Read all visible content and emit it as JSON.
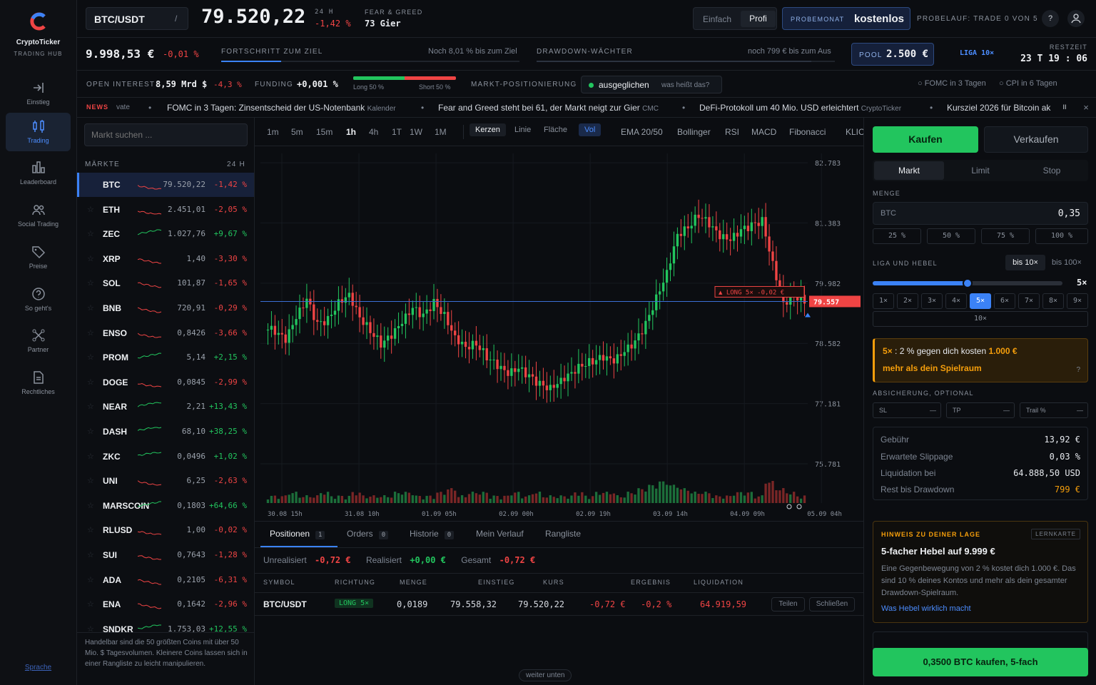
{
  "brand": {
    "name": "CryptoTicker",
    "sub": "TRADING HUB"
  },
  "nav": [
    {
      "label": "Einstieg",
      "icon": "enter-icon"
    },
    {
      "label": "Trading",
      "icon": "candles-icon"
    },
    {
      "label": "Leaderboard",
      "icon": "bars-icon"
    },
    {
      "label": "Social Trading",
      "icon": "people-icon"
    },
    {
      "label": "Preise",
      "icon": "tag-icon"
    },
    {
      "label": "So geht's",
      "icon": "question-icon"
    },
    {
      "label": "Partner",
      "icon": "partner-icon"
    },
    {
      "label": "Rechtliches",
      "icon": "document-icon"
    }
  ],
  "nav_footer": "Sprache",
  "header": {
    "pair": "BTC/USDT",
    "pair_sep": "/",
    "price": "79.520,22",
    "change_label": "24 H",
    "change": "-1,42 %",
    "fg_label": "FEAR & GREED",
    "fg_value": "73 Gier",
    "mode_simple": "Einfach",
    "mode_pro": "Profi",
    "promo_small": "PROBEMONAT",
    "promo_big": "kostenlos",
    "trial": "PROBELAUF: TRADE 0 VON 5",
    "help": "?"
  },
  "row2": {
    "balance": "9.998,53 €",
    "balance_change": "-0,01 %",
    "progress_label": "FORTSCHRITT ZUM ZIEL",
    "progress_note": "Noch 8,01 % bis zum Ziel",
    "progress_value": 0.2,
    "drawdown_label": "DRAWDOWN-WÄCHTER",
    "drawdown_note": "noch 799 € bis zum Aus",
    "drawdown_value": 0.92,
    "pool_label": "POOL",
    "pool_value": "2.500 €",
    "league": "LIGA 10×",
    "time_label": "RESTZEIT",
    "time_value": "23 T 19 : 06"
  },
  "row3": {
    "oi_label": "OPEN INTEREST",
    "oi_value": "8,59 Mrd $",
    "oi_change": "-4,3 %",
    "funding_label": "FUNDING",
    "funding_value": "+0,001 %",
    "long_label": "Long 50 %",
    "short_label": "Short 50 %",
    "long_ratio": 0.5,
    "pos_label": "MARKT-POSITIONIERUNG",
    "pos_value": "ausgeglichen",
    "pos_hint": "was heißt das?",
    "event1": "FOMC in 3 Tagen",
    "event2": "CPI in 6 Tagen"
  },
  "news": {
    "tag": "NEWS",
    "items": [
      {
        "text": "vate",
        "src": ""
      },
      {
        "text": "FOMC in 3 Tagen: Zinsentscheid der US-Notenbank",
        "src": "Kalender"
      },
      {
        "text": "Fear and Greed steht bei 61, der Markt neigt zur Gier",
        "src": "CMC"
      },
      {
        "text": "DeFi-Protokoll um 40 Mio. USD erleichtert",
        "src": "CryptoTicker"
      },
      {
        "text": "Kursziel 2026 für Bitcoin ak",
        "src": ""
      }
    ],
    "pause": "II",
    "close": "×"
  },
  "markets": {
    "search_placeholder": "Markt suchen ...",
    "header": "MÄRKTE",
    "col": "24 H",
    "note": "Handelbar sind die 50 größten Coins mit über 50 Mio. $ Tagesvolumen. Kleinere Coins lassen sich in einer Rangliste zu leicht manipulieren.",
    "rows": [
      {
        "sym": "BTC",
        "price": "79.520,22",
        "chg": "-1,42 %",
        "dir": "dn"
      },
      {
        "sym": "ETH",
        "price": "2.451,01",
        "chg": "-2,05 %",
        "dir": "dn"
      },
      {
        "sym": "ZEC",
        "price": "1.027,76",
        "chg": "+9,67 %",
        "dir": "up"
      },
      {
        "sym": "XRP",
        "price": "1,40",
        "chg": "-3,30 %",
        "dir": "dn"
      },
      {
        "sym": "SOL",
        "price": "101,87",
        "chg": "-1,65 %",
        "dir": "dn"
      },
      {
        "sym": "BNB",
        "price": "720,91",
        "chg": "-0,29 %",
        "dir": "dn"
      },
      {
        "sym": "ENSO",
        "price": "0,8426",
        "chg": "-3,66 %",
        "dir": "dn"
      },
      {
        "sym": "PROM",
        "price": "5,14",
        "chg": "+2,15 %",
        "dir": "up"
      },
      {
        "sym": "DOGE",
        "price": "0,0845",
        "chg": "-2,99 %",
        "dir": "dn"
      },
      {
        "sym": "NEAR",
        "price": "2,21",
        "chg": "+13,43 %",
        "dir": "up"
      },
      {
        "sym": "DASH",
        "price": "68,10",
        "chg": "+38,25 %",
        "dir": "up"
      },
      {
        "sym": "ZKC",
        "price": "0,0496",
        "chg": "+1,02 %",
        "dir": "up"
      },
      {
        "sym": "UNI",
        "price": "6,25",
        "chg": "-2,63 %",
        "dir": "dn"
      },
      {
        "sym": "MARSCOIN",
        "price": "0,1803",
        "chg": "+64,66 %",
        "dir": "up"
      },
      {
        "sym": "RLUSD",
        "price": "1,00",
        "chg": "-0,02 %",
        "dir": "dn"
      },
      {
        "sym": "SUI",
        "price": "0,7643",
        "chg": "-1,28 %",
        "dir": "dn"
      },
      {
        "sym": "ADA",
        "price": "0,2105",
        "chg": "-6,31 %",
        "dir": "dn"
      },
      {
        "sym": "ENA",
        "price": "0,1642",
        "chg": "-2,96 %",
        "dir": "dn"
      },
      {
        "sym": "SNDKR",
        "price": "1.753,03",
        "chg": "+12,55 %",
        "dir": "up"
      }
    ]
  },
  "toolbar": {
    "timeframes": [
      "1m",
      "5m",
      "15m",
      "1h",
      "4h",
      "1T",
      "1W",
      "1M"
    ],
    "active_tf": "1h",
    "types": [
      "Kerzen",
      "Linie",
      "Fläche",
      "Vol"
    ],
    "indicators": [
      "EMA 20/50",
      "Bollinger",
      "RSI",
      "MACD",
      "Fibonacci",
      "KLIC"
    ]
  },
  "chart_data": {
    "type": "candlestick",
    "yticks": [
      "82.783",
      "81.383",
      "79.982",
      "78.582",
      "77.181",
      "75.781"
    ],
    "xticks": [
      "30.08 15h",
      "31.08 10h",
      "01.09 05h",
      "02.09 00h",
      "02.09 19h",
      "03.09 14h",
      "04.09 09h",
      "05.09 04h"
    ],
    "last_price": "79.557",
    "position_tag": "▲ LONG 5× -0,02 €",
    "close_series": [
      78.9,
      78.7,
      79.2,
      79.6,
      79.0,
      79.1,
      79.5,
      79.7,
      79.2,
      78.9,
      78.6,
      78.8,
      79.1,
      79.4,
      79.2,
      79.5,
      79.2,
      78.7,
      78.5,
      78.6,
      78.3,
      78.1,
      77.9,
      78.0,
      77.8,
      77.6,
      77.5,
      77.7,
      77.9,
      78.1,
      78.2,
      78.3,
      78.2,
      78.4,
      78.6,
      79.0,
      79.6,
      80.2,
      81.1,
      81.3,
      81.6,
      81.4,
      81.1,
      81.0,
      81.2,
      81.3,
      81.4,
      80.4,
      79.5,
      79.7,
      79.6
    ],
    "vol": [
      1,
      1,
      2,
      1,
      1,
      2,
      1,
      1,
      2,
      1,
      1,
      1,
      2,
      2,
      1,
      1,
      2,
      3,
      1,
      2,
      2,
      1,
      1,
      2,
      1,
      2,
      1,
      1,
      1,
      2,
      1,
      2,
      2,
      1,
      2,
      3,
      4,
      5,
      4,
      3,
      2,
      2,
      1,
      1,
      2,
      2,
      1,
      5,
      3,
      2,
      1
    ]
  },
  "bottom": {
    "tabs": [
      {
        "label": "Positionen",
        "count": "1"
      },
      {
        "label": "Orders",
        "count": "0"
      },
      {
        "label": "Historie",
        "count": "0"
      },
      {
        "label": "Mein Verlauf",
        "count": ""
      },
      {
        "label": "Rangliste",
        "count": ""
      }
    ],
    "unreal_label": "Unrealisiert",
    "unreal": "-0,72 €",
    "real_label": "Realisiert",
    "real": "+0,00 €",
    "total_label": "Gesamt",
    "total": "-0,72 €",
    "cols": [
      "SYMBOL",
      "RICHTUNG",
      "MENGE",
      "EINSTIEG",
      "KURS",
      "ERGEBNIS",
      "LIQUIDATION"
    ],
    "row": {
      "sym": "BTC/USDT",
      "dir": "LONG 5×",
      "qty": "0,0189",
      "entry": "79.558,32",
      "price": "79.520,22",
      "pnl": "-0,72 €",
      "pnl_pct": "-0,2 %",
      "liq": "64.919,59"
    },
    "share": "Teilen",
    "close": "Schließen",
    "scroll": "weiter unten"
  },
  "order": {
    "buy": "Kaufen",
    "sell": "Verkaufen",
    "types": [
      "Markt",
      "Limit",
      "Stop"
    ],
    "qty_label": "MENGE",
    "qty_asset": "BTC",
    "qty_value": "0,35",
    "pcts": [
      "25 %",
      "50 %",
      "75 %",
      "100 %"
    ],
    "lev_label": "LIGA UND HEBEL",
    "lev_opt1": "bis 10×",
    "lev_opt2": "bis 100×",
    "lev_value": "5×",
    "lev_fraction": 0.5,
    "lev_steps": [
      "1×",
      "2×",
      "3×",
      "4×",
      "5×",
      "6×",
      "7×",
      "8×",
      "9×",
      "10×"
    ],
    "active_step": "5×",
    "warn_line1a": "5×",
    "warn_line1b": ": 2 % gegen dich kosten",
    "warn_line1c": "1.000 €",
    "warn_line2": "mehr als dein Spielraum",
    "warn_help": "?",
    "protect_label": "ABSICHERUNG, OPTIONAL",
    "sl": "SL",
    "tp": "TP",
    "trail": "Trail %",
    "dash": "—",
    "fee_label": "Gebühr",
    "fee": "13,92 €",
    "slip_label": "Erwartete Slippage",
    "slip": "0,03 %",
    "liq_label": "Liquidation bei",
    "liq": "64.888,50 USD",
    "rest_label": "Rest bis Drawdown",
    "rest": "799 €",
    "hint_title": "HINWEIS ZU DEINER LAGE",
    "hint_tag": "LERNKARTE",
    "hint_head": "5-facher Hebel auf 9.999 €",
    "hint_body": "Eine Gegenbewegung von 2 % kostet dich 1.000 €. Das sind 10 % deines Kontos und mehr als dein gesamter Drawdown-Spielraum.",
    "hint_link": "Was Hebel wirklich macht",
    "cta": "0,3500 BTC kaufen, 5-fach"
  },
  "colors": {
    "accent": "#3b82f6",
    "up": "#22c55e",
    "down": "#ef4444",
    "warn": "#f59e0b"
  }
}
